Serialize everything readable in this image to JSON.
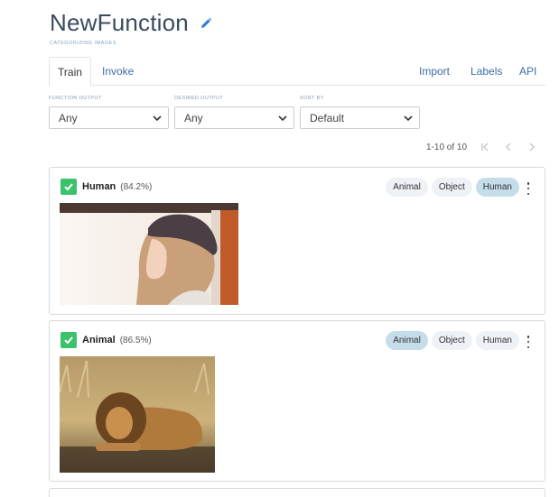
{
  "header": {
    "title": "NewFunction",
    "subtitle": "CATEGORIZING IMAGES"
  },
  "tabs": {
    "train": "Train",
    "invoke": "Invoke",
    "import": "Import",
    "labels": "Labels",
    "api": "API"
  },
  "filters": {
    "function_output": {
      "label": "FUNCTION OUTPUT",
      "value": "Any"
    },
    "desired_output": {
      "label": "DESIRED OUTPUT",
      "value": "Any"
    },
    "sort_by": {
      "label": "SORT BY",
      "value": "Default"
    }
  },
  "pager": {
    "range": "1-10 of 10"
  },
  "cards": [
    {
      "label": "Human",
      "confidence": "(84.2%)",
      "chips": [
        "Animal",
        "Object",
        "Human"
      ],
      "active": "Human"
    },
    {
      "label": "Animal",
      "confidence": "(86.5%)",
      "chips": [
        "Animal",
        "Object",
        "Human"
      ],
      "active": "Animal"
    }
  ],
  "colors": {
    "accent": "#3c6ea5",
    "check": "#3cc26a",
    "chip_active": "#c5dde9",
    "chip": "#eef2f6"
  }
}
